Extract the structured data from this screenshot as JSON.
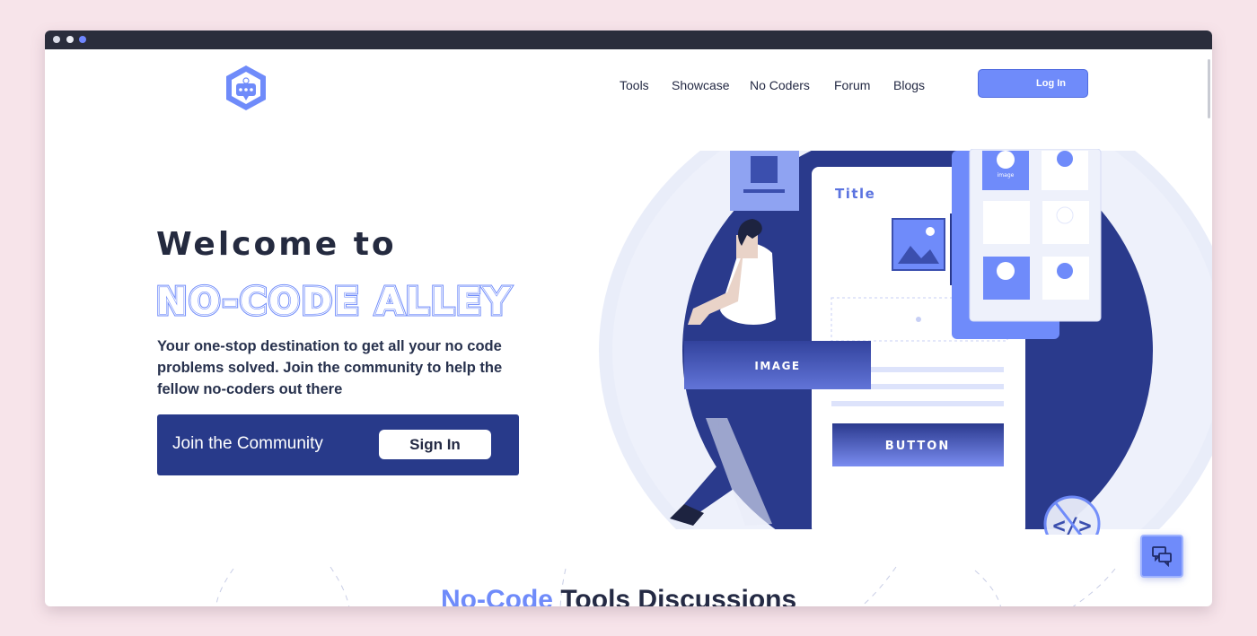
{
  "brand": {
    "accent": "#6f8bfa",
    "primary_dark": "#283a8a"
  },
  "nav": {
    "tools": "Tools",
    "showcase": "Showcase",
    "no_coders": "No Coders",
    "forum": "Forum",
    "blogs": "Blogs",
    "login": "Log In"
  },
  "hero": {
    "welcome": "Welcome to",
    "brand_name": "NO-CODE ALLEY",
    "description_before": "Your one-stop destination to get all your ",
    "description_bold": "no code",
    "description_after": " problems solved. Join the community to help the fellow no-coders out there",
    "cta_text": "Join the Community",
    "signin": "Sign In"
  },
  "illustration": {
    "title": "Title",
    "image_label": "IMAGE",
    "button_label": "BUTTON",
    "card_caption": "image"
  },
  "section": {
    "heading_accent": "No-Code",
    "heading_rest": " Tools Discussions"
  },
  "icons": {
    "logo": "hexagon-chat-logo",
    "chat": "chat-bubbles-icon",
    "code": "code-brackets-icon"
  }
}
